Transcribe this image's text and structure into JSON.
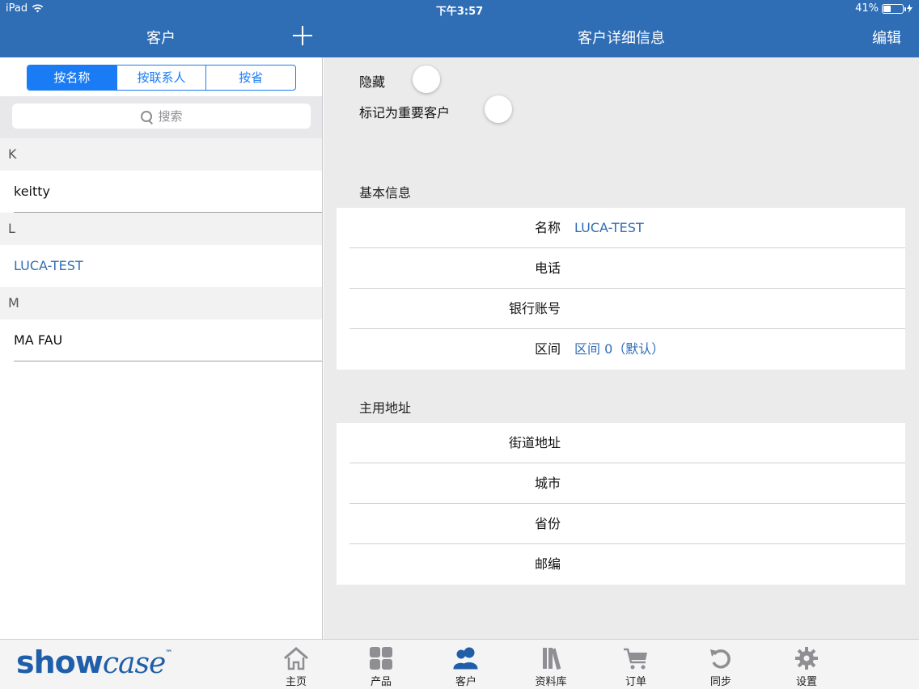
{
  "status_bar": {
    "device": "iPad",
    "time": "下午3:57",
    "battery": "41%",
    "battery_level": 0.41
  },
  "nav": {
    "left_title": "客户",
    "right_title": "客户详细信息",
    "edit_label": "编辑"
  },
  "segments": [
    "按名称",
    "按联系人",
    "按省"
  ],
  "selected_segment": "按名称",
  "search": {
    "placeholder": "搜索"
  },
  "customers": {
    "sections": [
      {
        "letter": "K",
        "items": [
          "keitty"
        ]
      },
      {
        "letter": "L",
        "items": [
          "LUCA-TEST"
        ]
      },
      {
        "letter": "M",
        "items": [
          "MA FAU"
        ]
      }
    ],
    "selected": "LUCA-TEST"
  },
  "toggles": {
    "hide_label": "隐藏",
    "important_label": "标记为重要客户"
  },
  "basic_info": {
    "title": "基本信息",
    "rows": [
      {
        "label": "名称",
        "value": "LUCA-TEST"
      },
      {
        "label": "电话",
        "value": ""
      },
      {
        "label": "银行账号",
        "value": ""
      },
      {
        "label": "区间",
        "value": "区间 0（默认）"
      }
    ]
  },
  "address": {
    "title": "主用地址",
    "rows": [
      {
        "label": "街道地址",
        "value": ""
      },
      {
        "label": "城市",
        "value": ""
      },
      {
        "label": "省份",
        "value": ""
      },
      {
        "label": "邮编",
        "value": ""
      }
    ]
  },
  "brand": {
    "bold": "show",
    "script": "case",
    "tm": "™"
  },
  "tabs": [
    {
      "label": "主页",
      "icon": "home-icon"
    },
    {
      "label": "产品",
      "icon": "products-icon"
    },
    {
      "label": "客户",
      "icon": "customers-icon",
      "active": true
    },
    {
      "label": "资料库",
      "icon": "library-icon"
    },
    {
      "label": "订单",
      "icon": "cart-icon"
    },
    {
      "label": "同步",
      "icon": "sync-icon"
    },
    {
      "label": "设置",
      "icon": "gear-icon"
    }
  ],
  "colors": {
    "nav_blue": "#2f6db5",
    "accent_blue": "#1a7cf5",
    "brand_blue": "#1f5ea8"
  }
}
